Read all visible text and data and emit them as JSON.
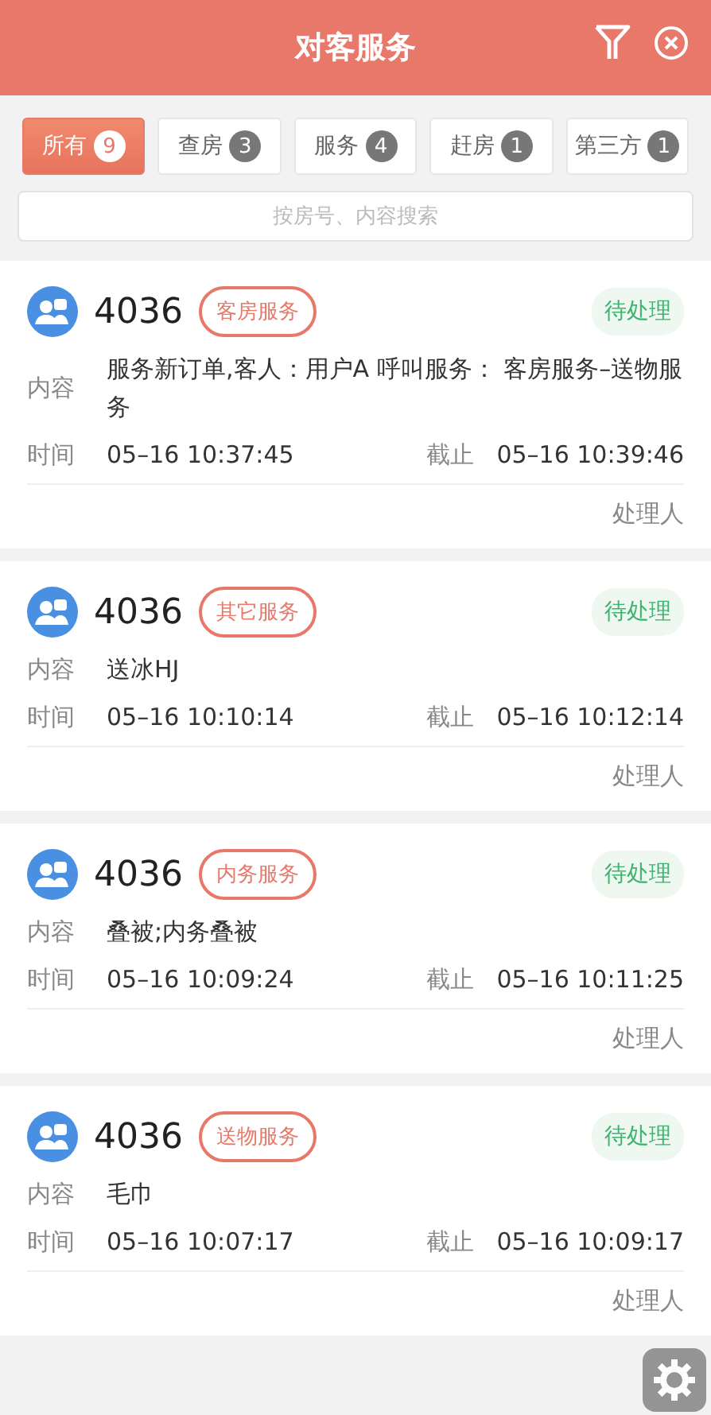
{
  "header": {
    "title": "对客服务"
  },
  "tabs": [
    {
      "label": "所有",
      "count": "9",
      "selected": true
    },
    {
      "label": "查房",
      "count": "3",
      "selected": false
    },
    {
      "label": "服务",
      "count": "4",
      "selected": false
    },
    {
      "label": "赶房",
      "count": "1",
      "selected": false
    },
    {
      "label": "第三方",
      "count": "1",
      "selected": false
    }
  ],
  "search": {
    "placeholder": "按房号、内容搜索"
  },
  "orders": [
    {
      "room": "4036",
      "tag": "客房服务",
      "status": "待处理",
      "content_label": "内容",
      "content": "服务新订单,客人：用户A 呼叫服务： 客房服务–送物服务",
      "time_label": "时间",
      "time": "05–16 10:37:45",
      "deadline_label": "截止",
      "deadline": "05–16 10:39:46",
      "handler": "处理人"
    },
    {
      "room": "4036",
      "tag": "其它服务",
      "status": "待处理",
      "content_label": "内容",
      "content": "送冰HJ",
      "time_label": "时间",
      "time": "05–16 10:10:14",
      "deadline_label": "截止",
      "deadline": "05–16 10:12:14",
      "handler": "处理人"
    },
    {
      "room": "4036",
      "tag": "内务服务",
      "status": "待处理",
      "content_label": "内容",
      "content": "叠被;内务叠被",
      "time_label": "时间",
      "time": "05–16 10:09:24",
      "deadline_label": "截止",
      "deadline": "05–16 10:11:25",
      "handler": "处理人"
    },
    {
      "room": "4036",
      "tag": "送物服务",
      "status": "待处理",
      "content_label": "内容",
      "content": "毛巾",
      "time_label": "时间",
      "time": "05–16 10:07:17",
      "deadline_label": "截止",
      "deadline": "05–16 10:09:17",
      "handler": "处理人"
    }
  ]
}
